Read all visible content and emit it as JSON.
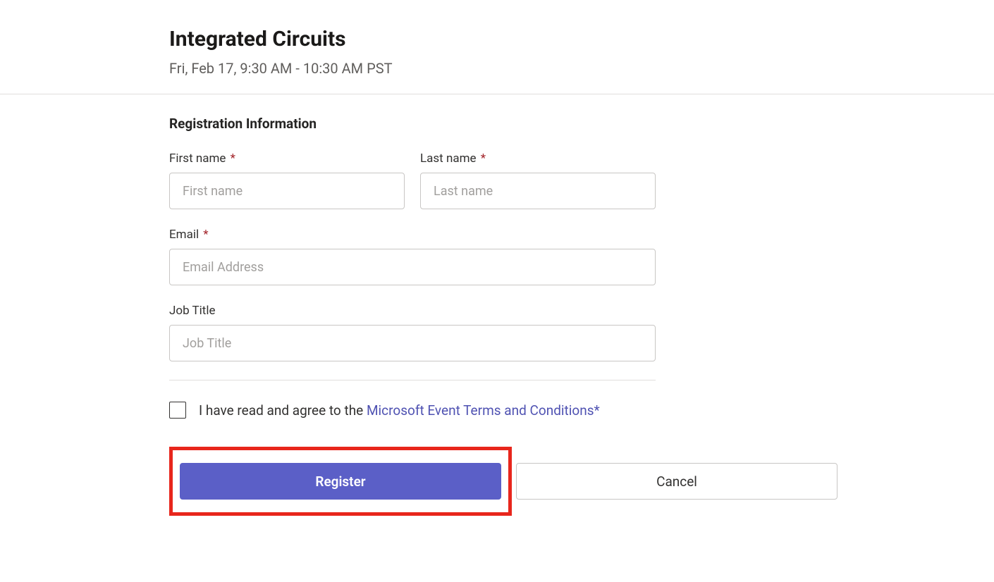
{
  "event": {
    "title": "Integrated Circuits",
    "datetime": "Fri, Feb 17, 9:30 AM - 10:30 AM PST"
  },
  "form": {
    "section_title": "Registration Information",
    "first_name": {
      "label": "First name",
      "placeholder": "First name",
      "required": true
    },
    "last_name": {
      "label": "Last name",
      "placeholder": "Last name",
      "required": true
    },
    "email": {
      "label": "Email",
      "placeholder": "Email Address",
      "required": true
    },
    "job_title": {
      "label": "Job Title",
      "placeholder": "Job Title",
      "required": false
    }
  },
  "terms": {
    "prefix": "I have read and agree to the ",
    "link_text": "Microsoft Event Terms and Conditions",
    "asterisk": "*"
  },
  "buttons": {
    "register": "Register",
    "cancel": "Cancel"
  },
  "required_mark": " *"
}
